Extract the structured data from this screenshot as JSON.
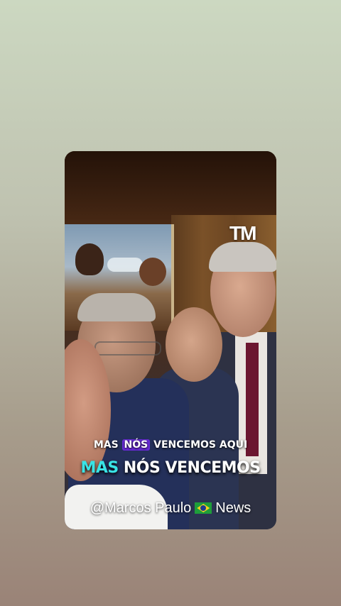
{
  "overlay": {
    "logo": "TM",
    "caption_line1_a": "MAS ",
    "caption_line1_hl": "NÓS",
    "caption_line1_b": " VENCEMOS AQUI",
    "caption_line2_hl": "MAS",
    "caption_line2_b": " NÓS VENCEMOS",
    "credit_a": "@Marcos Paulo",
    "credit_b": "News",
    "flag_icon": "brazil-flag-icon"
  },
  "colors": {
    "caption_highlight_bg": "#6a2bd8",
    "caption_highlight_text": "#39e3e6"
  }
}
